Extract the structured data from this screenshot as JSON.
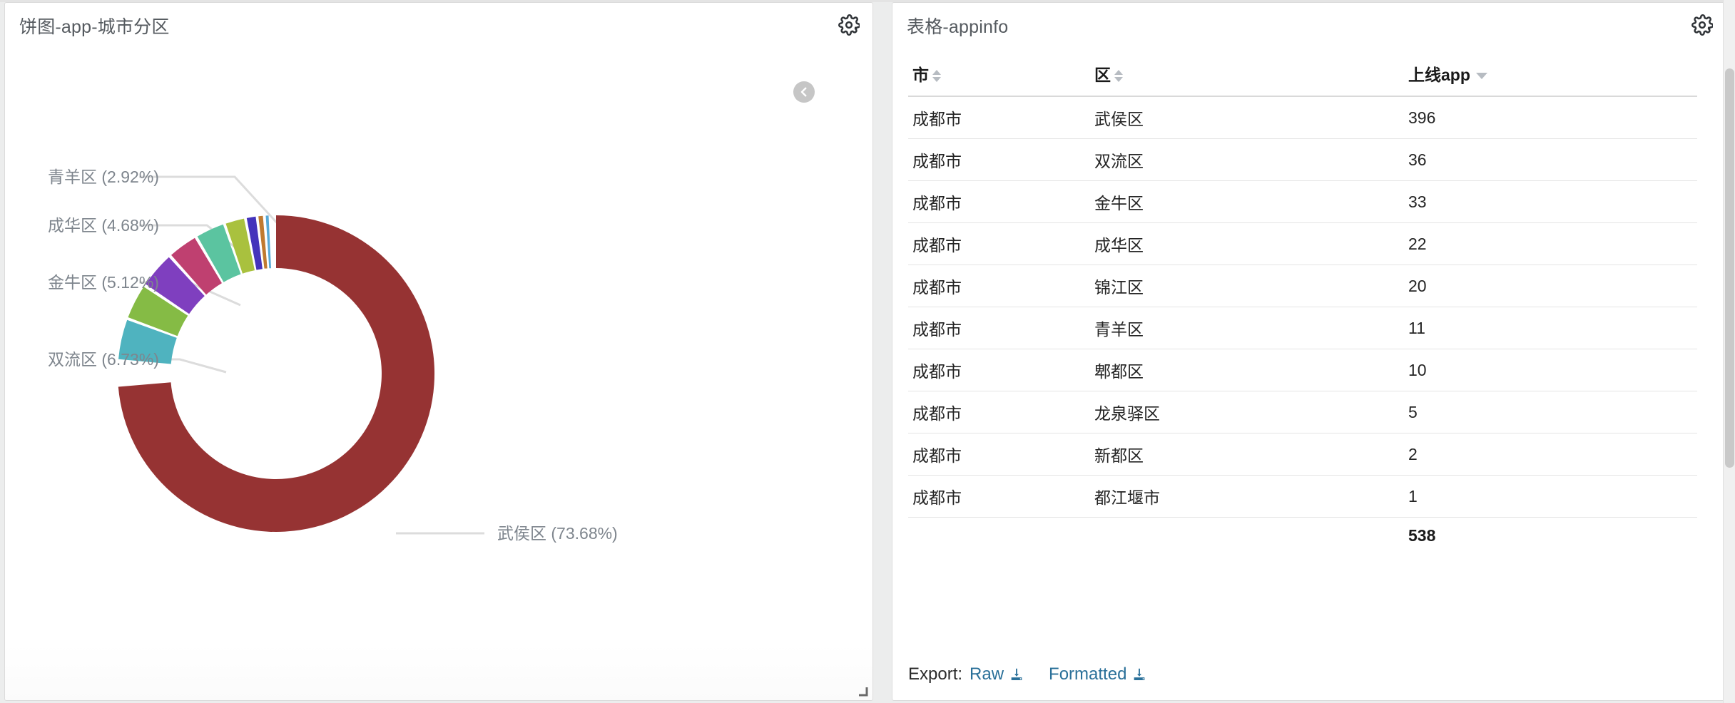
{
  "left_panel": {
    "title": "饼图-app-城市分区",
    "gear_icon": "gear-icon",
    "collapse_icon": "chevron-left-icon",
    "resize_icon": "resize-handle-icon"
  },
  "right_panel": {
    "title": "表格-appinfo",
    "gear_icon": "gear-icon"
  },
  "table": {
    "columns": [
      {
        "label": "市",
        "sort": "both"
      },
      {
        "label": "区",
        "sort": "both"
      },
      {
        "label": "上线app",
        "sort": "desc"
      }
    ],
    "rows": [
      {
        "city": "成都市",
        "district": "武侯区",
        "apps": "396"
      },
      {
        "city": "成都市",
        "district": "双流区",
        "apps": "36"
      },
      {
        "city": "成都市",
        "district": "金牛区",
        "apps": "33"
      },
      {
        "city": "成都市",
        "district": "成华区",
        "apps": "22"
      },
      {
        "city": "成都市",
        "district": "锦江区",
        "apps": "20"
      },
      {
        "city": "成都市",
        "district": "青羊区",
        "apps": "11"
      },
      {
        "city": "成都市",
        "district": "郫都区",
        "apps": "10"
      },
      {
        "city": "成都市",
        "district": "龙泉驿区",
        "apps": "5"
      },
      {
        "city": "成都市",
        "district": "新都区",
        "apps": "2"
      },
      {
        "city": "成都市",
        "district": "都江堰市",
        "apps": "1"
      }
    ],
    "total": "538"
  },
  "export": {
    "label": "Export:",
    "raw_label": "Raw",
    "formatted_label": "Formatted",
    "raw_icon": "download-icon",
    "formatted_icon": "download-icon"
  },
  "chart_data": {
    "type": "pie",
    "variant": "donut",
    "title": "饼图-app-城市分区",
    "categories": [
      "武侯区",
      "双流区",
      "金牛区",
      "成华区",
      "锦江区",
      "青羊区",
      "郫都区",
      "龙泉驿区",
      "新都区",
      "都江堰市"
    ],
    "values": [
      396,
      36,
      33,
      22,
      20,
      11,
      10,
      5,
      2,
      1
    ],
    "percents": [
      73.68,
      6.73,
      5.12,
      4.68,
      2.92,
      2.92,
      1.86,
      0.93,
      0.37,
      0.19
    ],
    "total": 538,
    "colors": [
      "#963333",
      "#4fb3bf",
      "#85bb45",
      "#7f3fbf",
      "#bf4070",
      "#5bc4a0",
      "#a9c13e",
      "#4433bb",
      "#c07a30",
      "#57a9d6"
    ],
    "visible_labels": [
      {
        "name": "武侯区",
        "text": "武侯区 (73.68%)"
      },
      {
        "name": "双流区",
        "text": "双流区 (6.73%)"
      },
      {
        "name": "金牛区",
        "text": "金牛区 (5.12%)"
      },
      {
        "name": "成华区",
        "text": "成华区 (4.68%)"
      },
      {
        "name": "青羊区",
        "text": "青羊区 (2.92%)"
      }
    ],
    "legend": "none",
    "label_style": "outside-with-leader-lines",
    "start_angle_deg": 0,
    "direction": "clockwise"
  }
}
